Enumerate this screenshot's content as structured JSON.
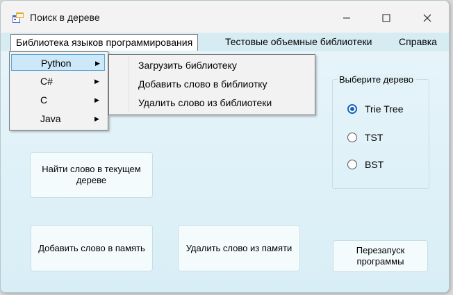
{
  "window": {
    "title": "Поиск в дереве"
  },
  "menubar": {
    "items": [
      {
        "label": "Библиотека языков программирования"
      },
      {
        "label": "Тестовые объемные библиотеки"
      },
      {
        "label": "Справка"
      }
    ]
  },
  "dropdown": {
    "items": [
      {
        "label": "Python",
        "highlighted": true
      },
      {
        "label": "C#"
      },
      {
        "label": "C"
      },
      {
        "label": "Java"
      }
    ]
  },
  "submenu": {
    "items": [
      {
        "label": "Загрузить библиотеку"
      },
      {
        "label": "Добавить слово в библиотку"
      },
      {
        "label": "Удалить слово из библиотеки"
      }
    ]
  },
  "buttons": {
    "find": "Найти слово в текущем дереве",
    "add": "Добавить слово в память",
    "delete": "Удалить слово из памяти",
    "restart": "Перезапуск программы"
  },
  "tree_select": {
    "title": "Выберите дерево",
    "options": [
      {
        "label": "Trie Tree",
        "checked": true
      },
      {
        "label": "TST",
        "checked": false
      },
      {
        "label": "BST",
        "checked": false
      }
    ]
  },
  "colors": {
    "accent": "#1565c0",
    "highlight": "#cde8f8",
    "background": "#eaf6fa"
  }
}
